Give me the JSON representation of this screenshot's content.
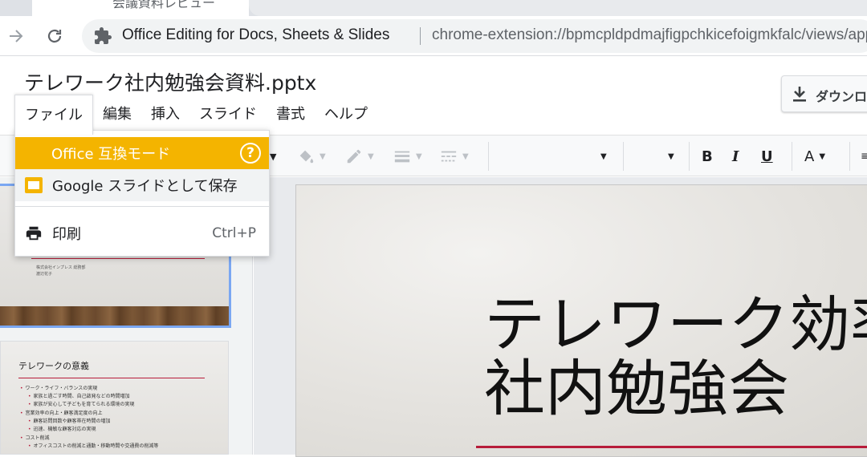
{
  "browser": {
    "tab_title": "会議資料レビュー",
    "site_name": "Office Editing for Docs, Sheets & Slides",
    "url": "chrome-extension://bpmcpldpdmajfigpchkicefoigmkfalc/views/app.html"
  },
  "document": {
    "title": "テレワーク社内勉強会資料.pptx",
    "download_label": "ダウンロード"
  },
  "menubar": {
    "file": "ファイル",
    "edit": "編集",
    "insert": "挿入",
    "slide": "スライド",
    "format": "書式",
    "help": "ヘルプ"
  },
  "file_menu": {
    "office_mode": "Office 互換モード",
    "help_glyph": "?",
    "save_as_google": "Google スライドとして保存",
    "print": "印刷",
    "print_shortcut": "Ctrl+P"
  },
  "toolbar": {
    "bold": "B",
    "italic": "I",
    "underline": "U",
    "text_color": "A"
  },
  "filmstrip": {
    "slide1_meta1": "株式会社インプレス 総務部",
    "slide1_meta2": "渡辺花子",
    "slide2_title": "テレワークの意義",
    "slide2_bullets": [
      "ワーク・ライフ・バランスの実現",
      "家族と過ごす時間、自己啟発などの時間増加",
      "家族が安心して子どもを育てられる環境の実現",
      "営業効率の向上・顧客満足度の向上",
      "顧客訪問回数や顧客帯在時間の増加",
      "迅速、機敏な顧客対応の実現",
      "コスト削減",
      "オフィスコストの削減と通勤・移動時間や交通費の削減等"
    ]
  },
  "slide": {
    "title_line1": "テレワーク効率",
    "title_line2": "社内勉強会"
  },
  "colors": {
    "office_mode_bg": "#f4b400",
    "accent_red": "#b71c3a",
    "selection_blue": "#7aa7f2"
  }
}
